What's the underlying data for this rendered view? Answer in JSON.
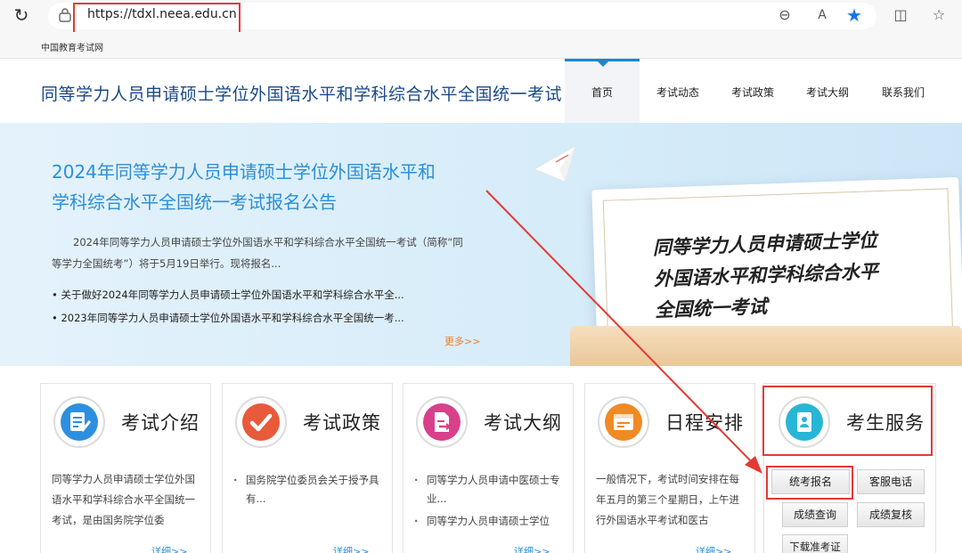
{
  "browser": {
    "url": "https://tdxl.neea.edu.cn",
    "bookmark": "中国教育考试网"
  },
  "header": {
    "site_title": "同等学力人员申请硕士学位外国语水平和学科综合水平全国统一考试",
    "nav": [
      {
        "label": "首页"
      },
      {
        "label": "考试动态"
      },
      {
        "label": "考试政策"
      },
      {
        "label": "考试大纲"
      },
      {
        "label": "联系我们"
      }
    ]
  },
  "banner": {
    "headline_line1": "2024年同等学力人员申请硕士学位外国语水平和",
    "headline_line2": "学科综合水平全国统一考试报名公告",
    "summary": "2024年同等学力人员申请硕士学位外国语水平和学科综合水平全国统一考试（简称“同等学力全国统考”）将于5月19日举行。现将报名...",
    "links": [
      "• 关于做好2024年同等学力人员申请硕士学位外国语水平和学科综合水平全...",
      "• 2023年同等学力人员申请硕士学位外国语水平和学科综合水平全国统一考..."
    ],
    "more": "更多>>",
    "paper_line1": "同等学力人员申请硕士学位",
    "paper_line2": "外国语水平和学科综合水平",
    "paper_line3": "全国统一考试"
  },
  "cards": [
    {
      "title": "考试介绍",
      "icon": "document-edit-icon",
      "body": "同等学力人员申请硕士学位外国语水平和学科综合水平全国统一考试，是由国务院学位委",
      "more": "详细>>"
    },
    {
      "title": "考试政策",
      "icon": "checkmark-icon",
      "list": [
        "国务院学位委员会关于授予具有..."
      ],
      "more": "详细>>"
    },
    {
      "title": "考试大纲",
      "icon": "document-export-icon",
      "list": [
        "同等学力人员申请中医硕士专业...",
        "同等学力人员申请硕士学位"
      ],
      "more": "详细>>"
    },
    {
      "title": "日程安排",
      "icon": "schedule-icon",
      "body": "一般情况下，考试时间安排在每年五月的第三个星期日，上午进行外国语水平考试和医古",
      "more": "详细>>"
    }
  ],
  "services": {
    "title": "考生服务",
    "icon": "address-book-icon",
    "buttons": [
      {
        "label": "统考报名"
      },
      {
        "label": "客服电话"
      },
      {
        "label": "成绩查询"
      },
      {
        "label": "成绩复核"
      },
      {
        "label": "下载准考证"
      }
    ]
  },
  "colors": {
    "brand_blue": "#1a86d0",
    "title_blue": "#1a4a8a",
    "headline_blue": "#2b8fd6",
    "more_orange": "#f07c1e",
    "annotation_red": "#e53935"
  }
}
